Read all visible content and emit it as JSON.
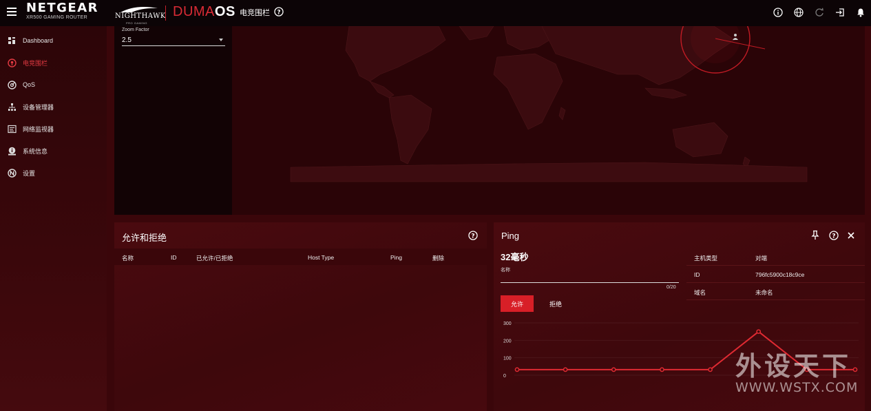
{
  "brand": {
    "name": "NETGEAR",
    "model": "XR500 GAMING ROUTER",
    "partner": "NIGHTHAWK",
    "partner_sub": "PRO GAMING",
    "os_part1": "DUMA",
    "os_part2": "OS"
  },
  "header": {
    "page_title": "电竞围栏",
    "icons": [
      "info-icon",
      "globe-icon",
      "refresh-icon",
      "logout-icon",
      "bell-icon"
    ]
  },
  "sidebar": {
    "items": [
      {
        "label": "Dashboard",
        "icon": "dashboard-icon",
        "active": false
      },
      {
        "label": "电竞围栏",
        "icon": "geofence-icon",
        "active": true
      },
      {
        "label": "QoS",
        "icon": "qos-icon",
        "active": false
      },
      {
        "label": "设备管理器",
        "icon": "device-manager-icon",
        "active": false
      },
      {
        "label": "网络监视器",
        "icon": "network-monitor-icon",
        "active": false
      },
      {
        "label": "系统信息",
        "icon": "system-info-icon",
        "active": false
      },
      {
        "label": "设置",
        "icon": "settings-icon",
        "active": false
      }
    ]
  },
  "map": {
    "zoom_label": "Zoom Factor",
    "zoom_value": "2.5"
  },
  "allow_deny": {
    "title": "允许和拒绝",
    "columns": [
      "名称",
      "ID",
      "已允许/已拒绝",
      "Host Type",
      "Ping",
      "删除"
    ]
  },
  "ping_panel": {
    "title": "Ping",
    "ping_value": "32毫秒",
    "name_label": "名称",
    "name_value": "",
    "char_count": "0/20",
    "allow_button": "允许",
    "deny_button": "拒绝",
    "info": [
      {
        "key": "主机类型",
        "value": "对端"
      },
      {
        "key": "ID",
        "value": "796fc5900c18c9ce"
      },
      {
        "key": "域名",
        "value": "未命名"
      }
    ]
  },
  "chart_data": {
    "type": "line",
    "yticks": [
      "300",
      "200",
      "100",
      "0"
    ],
    "ylim": [
      0,
      300
    ],
    "series": [
      {
        "values": [
          32,
          32,
          32,
          32,
          32,
          250,
          32,
          32
        ]
      }
    ],
    "color": "#e02a32"
  },
  "watermark": {
    "text_cn": "外设天下",
    "text_en": "WWW.WSTX.COM"
  },
  "colors": {
    "accent": "#d81f27",
    "topbar": "#0c0406",
    "panel": "#4a0a0f"
  }
}
